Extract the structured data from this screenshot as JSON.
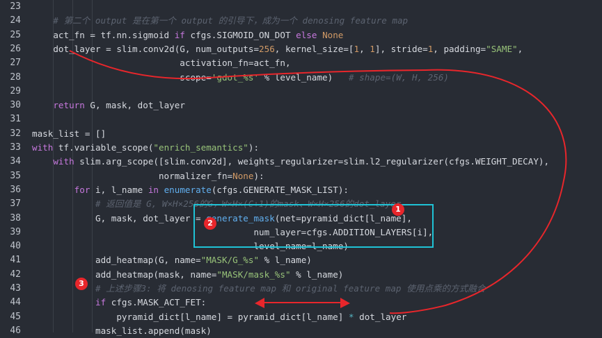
{
  "lines": [
    {
      "n": "23",
      "segs": []
    },
    {
      "n": "24",
      "segs": [
        {
          "t": "    ",
          "c": ""
        },
        {
          "t": "# 第二个 output 是在第一个 output 的引导下，成为一个 denosing feature map",
          "c": "cm"
        }
      ]
    },
    {
      "n": "25",
      "segs": [
        {
          "t": "    act_fn = tf.nn.sigmoid ",
          "c": ""
        },
        {
          "t": "if",
          "c": "kw"
        },
        {
          "t": " cfgs.SIGMOID_ON_DOT ",
          "c": ""
        },
        {
          "t": "else",
          "c": "kw"
        },
        {
          "t": " ",
          "c": ""
        },
        {
          "t": "None",
          "c": "cs"
        }
      ]
    },
    {
      "n": "26",
      "segs": [
        {
          "t": "    dot_layer = slim.conv2d(G, num_outputs=",
          "c": ""
        },
        {
          "t": "256",
          "c": "cs"
        },
        {
          "t": ", kernel_size=[",
          "c": ""
        },
        {
          "t": "1",
          "c": "cs"
        },
        {
          "t": ", ",
          "c": ""
        },
        {
          "t": "1",
          "c": "cs"
        },
        {
          "t": "], stride=",
          "c": ""
        },
        {
          "t": "1",
          "c": "cs"
        },
        {
          "t": ", padding=",
          "c": ""
        },
        {
          "t": "\"SAME\"",
          "c": "st"
        },
        {
          "t": ",",
          "c": ""
        }
      ]
    },
    {
      "n": "27",
      "segs": [
        {
          "t": "                            activation_fn=act_fn,",
          "c": ""
        }
      ]
    },
    {
      "n": "28",
      "segs": [
        {
          "t": "                            scope=",
          "c": ""
        },
        {
          "t": "'gdot_%s'",
          "c": "st"
        },
        {
          "t": " % level_name)   ",
          "c": ""
        },
        {
          "t": "# shape=(W, H, 256)",
          "c": "cm"
        }
      ]
    },
    {
      "n": "29",
      "segs": []
    },
    {
      "n": "30",
      "segs": [
        {
          "t": "    ",
          "c": ""
        },
        {
          "t": "return",
          "c": "kw"
        },
        {
          "t": " G, mask, dot_layer",
          "c": ""
        }
      ]
    },
    {
      "n": "31",
      "segs": []
    },
    {
      "n": "32",
      "segs": [
        {
          "t": "mask_list = []",
          "c": ""
        }
      ]
    },
    {
      "n": "33",
      "segs": [
        {
          "t": "with",
          "c": "kw"
        },
        {
          "t": " tf.variable_scope(",
          "c": ""
        },
        {
          "t": "\"enrich_semantics\"",
          "c": "st"
        },
        {
          "t": "):",
          "c": ""
        }
      ]
    },
    {
      "n": "34",
      "segs": [
        {
          "t": "    ",
          "c": ""
        },
        {
          "t": "with",
          "c": "kw"
        },
        {
          "t": " slim.arg_scope([slim.conv2d], weights_regularizer=slim.l2_regularizer(cfgs.WEIGHT_DECAY),",
          "c": ""
        }
      ]
    },
    {
      "n": "35",
      "segs": [
        {
          "t": "                        normalizer_fn=",
          "c": ""
        },
        {
          "t": "None",
          "c": "cs"
        },
        {
          "t": "):",
          "c": ""
        }
      ]
    },
    {
      "n": "36",
      "segs": [
        {
          "t": "        ",
          "c": ""
        },
        {
          "t": "for",
          "c": "kw"
        },
        {
          "t": " i, l_name ",
          "c": ""
        },
        {
          "t": "in",
          "c": "kw"
        },
        {
          "t": " ",
          "c": ""
        },
        {
          "t": "enumerate",
          "c": "fn"
        },
        {
          "t": "(cfgs.GENERATE_MASK_LIST):",
          "c": ""
        }
      ]
    },
    {
      "n": "37",
      "segs": [
        {
          "t": "            ",
          "c": ""
        },
        {
          "t": "# 返回值是 G, W×H×256的G，W×H×(C+1)的mask、W×H×256的dot_layer",
          "c": "cm"
        }
      ]
    },
    {
      "n": "38",
      "segs": [
        {
          "t": "            G, mask, dot_layer = ",
          "c": ""
        },
        {
          "t": "generate_mask",
          "c": "fn"
        },
        {
          "t": "(net=pyramid_dict[l_name],",
          "c": ""
        }
      ]
    },
    {
      "n": "39",
      "segs": [
        {
          "t": "                                          num_layer=cfgs.ADDITION_LAYERS[i],",
          "c": ""
        }
      ]
    },
    {
      "n": "40",
      "segs": [
        {
          "t": "                                          level_name=l_name)",
          "c": ""
        }
      ]
    },
    {
      "n": "41",
      "segs": [
        {
          "t": "            add_heatmap(G, name=",
          "c": ""
        },
        {
          "t": "\"MASK/G_%s\"",
          "c": "st"
        },
        {
          "t": " % l_name)",
          "c": ""
        }
      ]
    },
    {
      "n": "42",
      "segs": [
        {
          "t": "            add_heatmap(mask, name=",
          "c": ""
        },
        {
          "t": "\"MASK/mask_%s\"",
          "c": "st"
        },
        {
          "t": " % l_name)",
          "c": ""
        }
      ]
    },
    {
      "n": "43",
      "segs": [
        {
          "t": "            ",
          "c": ""
        },
        {
          "t": "# 上述步骤3: 将 denosing feature map 和 original feature map 使用点乘的方式融合",
          "c": "cm"
        }
      ]
    },
    {
      "n": "44",
      "segs": [
        {
          "t": "            ",
          "c": ""
        },
        {
          "t": "if",
          "c": "kw"
        },
        {
          "t": " cfgs.MASK_ACT_FET:",
          "c": ""
        }
      ]
    },
    {
      "n": "45",
      "segs": [
        {
          "t": "                pyramid_dict[l_name] = pyramid_dict[l_name] ",
          "c": ""
        },
        {
          "t": "*",
          "c": "op"
        },
        {
          "t": " dot_layer",
          "c": ""
        }
      ]
    },
    {
      "n": "46",
      "segs": [
        {
          "t": "            mask_list.append(mask)",
          "c": ""
        }
      ]
    }
  ],
  "badges": [
    "1",
    "2",
    "3"
  ],
  "colors": {
    "background": "#282c34",
    "keyword": "#c678dd",
    "string": "#98c379",
    "comment": "#5c6370",
    "annotation": "#e8262b",
    "highlight_box": "#1fc3d6"
  }
}
